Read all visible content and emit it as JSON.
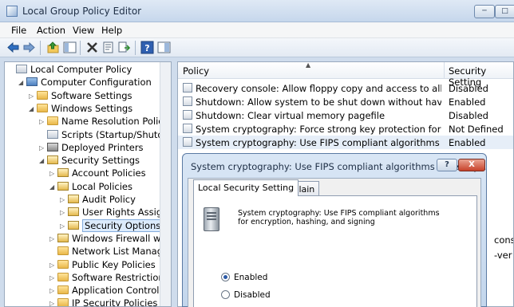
{
  "window": {
    "title": "Local Group Policy Editor"
  },
  "menu": {
    "items": [
      "File",
      "Action",
      "View",
      "Help"
    ]
  },
  "tree": {
    "items": [
      {
        "label": "Local Computer Policy",
        "icon": "policy-icon",
        "depth": 0,
        "arrow": ""
      },
      {
        "label": "Computer Configuration",
        "icon": "computer-icon",
        "depth": 1,
        "arrow": "expanded"
      },
      {
        "label": "Software Settings",
        "icon": "folder-icon",
        "depth": 2,
        "arrow": "collapsed"
      },
      {
        "label": "Windows Settings",
        "icon": "folder-icon",
        "depth": 2,
        "arrow": "expanded"
      },
      {
        "label": "Name Resolution Policy",
        "icon": "folder-icon",
        "depth": 3,
        "arrow": "collapsed"
      },
      {
        "label": "Scripts (Startup/Shutdown)",
        "icon": "script-icon",
        "depth": 3,
        "arrow": ""
      },
      {
        "label": "Deployed Printers",
        "icon": "printer-icon",
        "depth": 3,
        "arrow": "collapsed"
      },
      {
        "label": "Security Settings",
        "icon": "lock-icon",
        "depth": 3,
        "arrow": "expanded"
      },
      {
        "label": "Account Policies",
        "icon": "lock-icon",
        "depth": 4,
        "arrow": "collapsed"
      },
      {
        "label": "Local Policies",
        "icon": "lock-icon",
        "depth": 4,
        "arrow": "expanded"
      },
      {
        "label": "Audit Policy",
        "icon": "lock-icon",
        "depth": 5,
        "arrow": "collapsed"
      },
      {
        "label": "User Rights Assignment",
        "icon": "lock-icon",
        "depth": 5,
        "arrow": "collapsed"
      },
      {
        "label": "Security Options",
        "icon": "lock-icon",
        "depth": 5,
        "arrow": "collapsed",
        "selected": true
      },
      {
        "label": "Windows Firewall with Advanced Security",
        "icon": "lock-icon",
        "depth": 4,
        "arrow": "collapsed"
      },
      {
        "label": "Network List Manager Policies",
        "icon": "folder-icon",
        "depth": 4,
        "arrow": ""
      },
      {
        "label": "Public Key Policies",
        "icon": "folder-icon",
        "depth": 4,
        "arrow": "collapsed"
      },
      {
        "label": "Software Restriction Policies",
        "icon": "folder-icon",
        "depth": 4,
        "arrow": "collapsed"
      },
      {
        "label": "Application Control Policies",
        "icon": "folder-icon",
        "depth": 4,
        "arrow": "collapsed"
      },
      {
        "label": "IP Security Policies on Local Computer",
        "icon": "folder-icon",
        "depth": 4,
        "arrow": "collapsed"
      }
    ]
  },
  "list": {
    "columns": {
      "policy": "Policy",
      "setting": "Security Setting"
    },
    "rows": [
      {
        "policy": "Recovery console: Allow floppy copy and access to all drives an...",
        "setting": "Disabled"
      },
      {
        "policy": "Shutdown: Allow system to be shut down without having to log...",
        "setting": "Enabled"
      },
      {
        "policy": "Shutdown: Clear virtual memory pagefile",
        "setting": "Disabled"
      },
      {
        "policy": "System cryptography: Force strong key protection for user keys ...",
        "setting": "Not Defined"
      },
      {
        "policy": "System cryptography: Use FIPS compliant algorithms for encryp...",
        "setting": "Enabled",
        "selected": true
      }
    ],
    "edge_text_1": "cons",
    "edge_text_2": "-ver"
  },
  "dialog": {
    "title": "System cryptography: Use FIPS compliant algorithms for encry...",
    "help_label": "?",
    "close_label": "X",
    "tabs": [
      "Local Security Setting",
      "Explain"
    ],
    "description": "System cryptography: Use FIPS compliant algorithms for encryption, hashing, and signing",
    "options": [
      {
        "label": "Enabled",
        "checked": true
      },
      {
        "label": "Disabled",
        "checked": false
      }
    ]
  },
  "colors": {
    "accent": "#2b59a6",
    "selection": "#dcebfc",
    "close": "#c7422a"
  }
}
